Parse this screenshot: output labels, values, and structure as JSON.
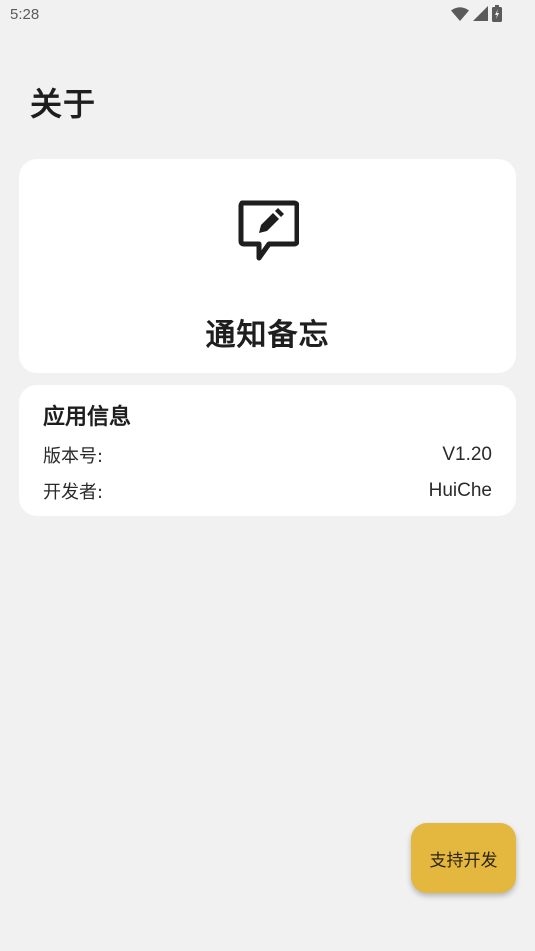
{
  "status_bar": {
    "time": "5:28",
    "icons": [
      "wifi-icon",
      "cellular-signal-icon",
      "battery-charging-icon"
    ]
  },
  "header": {
    "title": "关于"
  },
  "hero": {
    "icon": "message-edit-icon",
    "app_name": "通知备忘"
  },
  "app_info": {
    "title": "应用信息",
    "rows": [
      {
        "label": "版本号:",
        "value": "V1.20"
      },
      {
        "label": "开发者:",
        "value": "HuiChe"
      }
    ]
  },
  "fab": {
    "label": "支持开发"
  },
  "colors": {
    "background": "#f1f1f1",
    "card": "#ffffff",
    "accent": "#e4b73f",
    "text": "#1e1e1e"
  }
}
